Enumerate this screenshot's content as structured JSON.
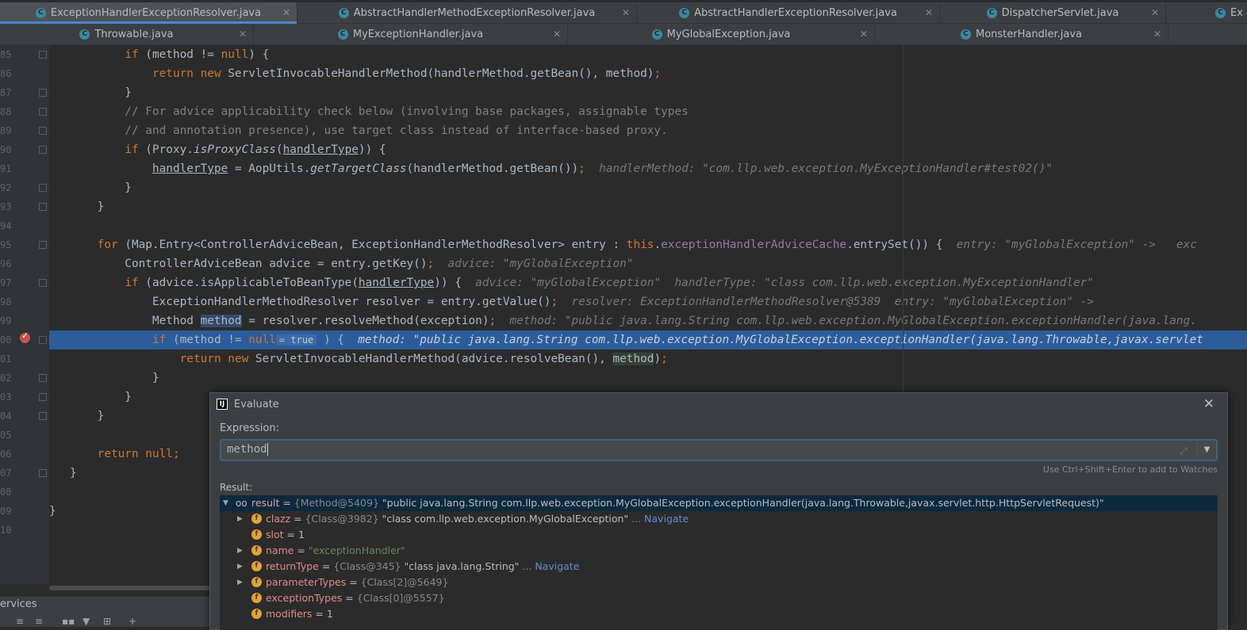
{
  "tabs_row1": [
    {
      "label": "ExceptionHandlerExceptionResolver.java",
      "active": true
    },
    {
      "label": "AbstractHandlerMethodExceptionResolver.java"
    },
    {
      "label": "AbstractHandlerExceptionResolver.java"
    },
    {
      "label": "DispatcherServlet.java"
    },
    {
      "label": "Ex"
    }
  ],
  "tabs_row2": [
    {
      "label": "Throwable.java"
    },
    {
      "label": "MyExceptionHandler.java"
    },
    {
      "label": "MyGlobalException.java"
    },
    {
      "label": "MonsterHandler.java"
    }
  ],
  "line_numbers": [
    "85",
    "86",
    "87",
    "88",
    "89",
    "90",
    "91",
    "92",
    "93",
    "94",
    "95",
    "96",
    "97",
    "98",
    "99",
    "00",
    "01",
    "02",
    "03",
    "04",
    "05",
    "06",
    "07",
    "08",
    "09",
    "10"
  ],
  "hints": {
    "h91": "handlerMethod: \"com.llp.web.exception.MyExceptionHandler#test02()\"",
    "h95": "entry: \"myGlobalException\" ->   exc",
    "h96": "advice: \"myGlobalException\"",
    "h97": "advice: \"myGlobalException\"  handlerType: \"class com.llp.web.exception.MyExceptionHandler\"",
    "h98": "resolver: ExceptionHandlerMethodResolver@5389  entry: \"myGlobalException\" ->",
    "h99": "method: \"public java.lang.String com.llp.web.exception.MyGlobalException.exceptionHandler(java.lang.",
    "h100": "method: \"public java.lang.String com.llp.web.exception.MyGlobalException.exceptionHandler(java.lang.Throwable,javax.servlet",
    "inlay100": "= true"
  },
  "services": {
    "title": "ervices",
    "toolbar": [
      "≡",
      "≡",
      "▪▪",
      "▼",
      "⊞",
      "+"
    ]
  },
  "evaluate": {
    "title": "Evaluate",
    "close": "✕",
    "icon_letter": "IJ",
    "expression_label": "Expression:",
    "expression_value": "method",
    "expand": "⤢",
    "dropdown": "▼",
    "watch_hint": "Use Ctrl+Shift+Enter to add to Watches",
    "result_label": "Result:",
    "result_root": {
      "name": "result",
      "ref": "{Method@5409}",
      "value": "\"public java.lang.String com.llp.web.exception.MyGlobalException.exceptionHandler(java.lang.Throwable,javax.servlet.http.HttpServletRequest)\""
    },
    "fields": [
      {
        "name": "clazz",
        "ref": "{Class@3982}",
        "value": "\"class com.llp.web.exception.MyGlobalException\"",
        "navigate": "... Navigate",
        "expandable": true
      },
      {
        "name": "slot",
        "ref": "",
        "value": "1",
        "navigate": "",
        "expandable": false
      },
      {
        "name": "name",
        "ref": "",
        "value": "\"exceptionHandler\"",
        "navigate": "",
        "expandable": true
      },
      {
        "name": "returnType",
        "ref": "{Class@345}",
        "value": "\"class java.lang.String\"",
        "navigate": "... Navigate",
        "expandable": true
      },
      {
        "name": "parameterTypes",
        "ref": "{Class[2]@5649}",
        "value": "",
        "navigate": "",
        "expandable": true
      },
      {
        "name": "exceptionTypes",
        "ref": "{Class[0]@5557}",
        "value": "",
        "navigate": "",
        "expandable": false
      },
      {
        "name": "modifiers",
        "ref": "",
        "value": "1",
        "navigate": "",
        "expandable": false
      }
    ]
  }
}
